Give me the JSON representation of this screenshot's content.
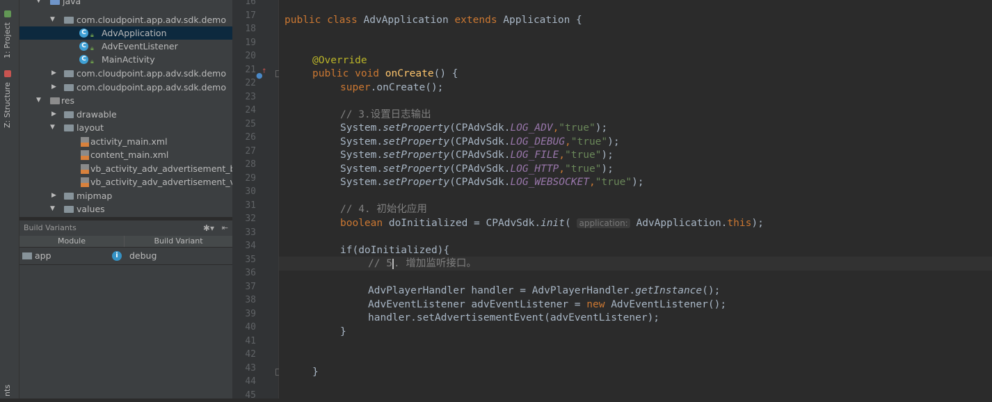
{
  "tool_tabs": {
    "project": "1: Project",
    "structure": "Z: Structure",
    "bottom": "nts"
  },
  "tree": {
    "java": "java",
    "pkg_main": "com.cloudpoint.app.adv.sdk.demo",
    "file_app": "AdvApplication",
    "file_listener": "AdvEventListener",
    "file_activity": "MainActivity",
    "pkg_2": "com.cloudpoint.app.adv.sdk.demo",
    "pkg_3": "com.cloudpoint.app.adv.sdk.demo",
    "res": "res",
    "drawable": "drawable",
    "layout": "layout",
    "x1": "activity_main.xml",
    "x2": "content_main.xml",
    "x3": "vb_activity_adv_advertisement_b",
    "x4": "vb_activity_adv_advertisement_v",
    "mipmap": "mipmap",
    "values": "values"
  },
  "build_variants": {
    "title": "Build Variants",
    "col_module": "Module",
    "col_variant": "Build Variant",
    "module": "app",
    "variant": "debug"
  },
  "gutter": {
    "lines": [
      "16",
      "17",
      "18",
      "19",
      "20",
      "21",
      "22",
      "23",
      "24",
      "25",
      "26",
      "27",
      "28",
      "29",
      "30",
      "31",
      "32",
      "33",
      "34",
      "35",
      "36",
      "37",
      "38",
      "39",
      "40",
      "41",
      "42",
      "43",
      "44",
      "45"
    ]
  },
  "code": {
    "l17_a": "public class ",
    "l17_b": "AdvApplication ",
    "l17_c": "extends ",
    "l17_d": "Application {",
    "l20": "@Override",
    "l21_a": "public void ",
    "l21_b": "onCreate",
    "l21_c": "() {",
    "l22_a": "super",
    "l22_b": ".onCreate();",
    "l24": "// 3.设置日志输出",
    "sys": "System.",
    "setp": "setProperty",
    "sdk": "(CPAdvSdk.",
    "f25": "LOG_ADV",
    "f26": "LOG_DEBUG",
    "f27": "LOG_FILE",
    "f28": "LOG_HTTP",
    "f29": "LOG_WEBSOCKET",
    "comma": ",",
    "true_str": "\"true\"",
    "close": ");",
    "l31": "// 4. 初始化应用",
    "l32_a": "boolean ",
    "l32_b": "doInitialized = CPAdvSdk.",
    "l32_c": "init",
    "l32_d": "( ",
    "l32_hint": "application:",
    "l32_e": " AdvApplication.",
    "l32_f": "this",
    "l32_g": ");",
    "l34": "if(doInitialized){",
    "l35_a": "// 5",
    "l35_b": ". 增加监听接口。",
    "l37_a": "AdvPlayerHandler handler = AdvPlayerHandler.",
    "l37_b": "getInstance",
    "l37_c": "();",
    "l38_a": "AdvEventListener advEventListener = ",
    "l38_b": "new ",
    "l38_c": "AdvEventListener();",
    "l39": "handler.setAdvertisementEvent(advEventListener);",
    "l40": "}",
    "l43": "}"
  }
}
